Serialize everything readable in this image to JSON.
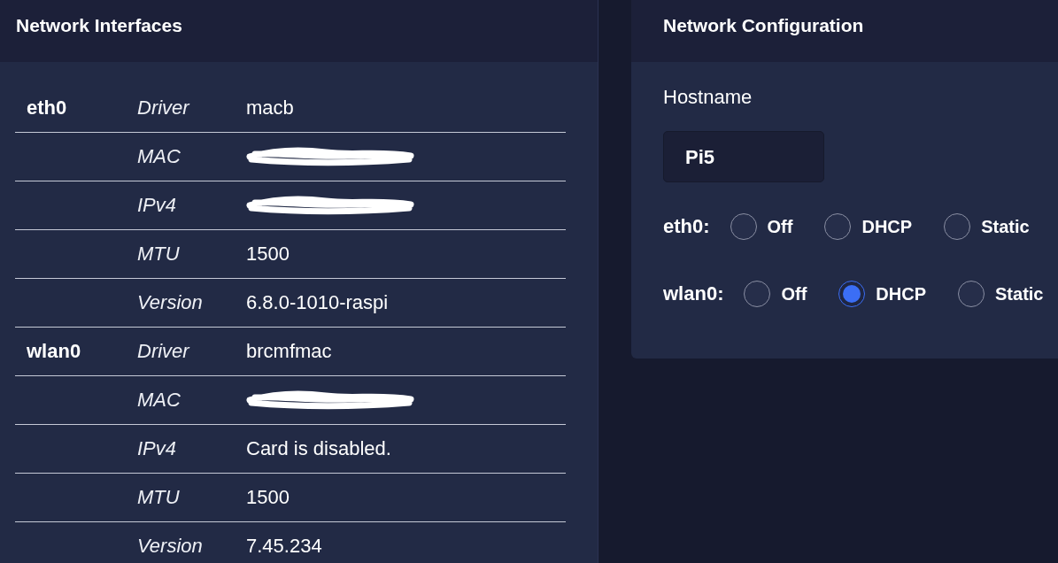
{
  "interfaces_panel": {
    "title": "Network Interfaces",
    "interfaces": [
      {
        "name": "eth0",
        "properties": [
          {
            "key": "Driver",
            "redacted": false,
            "value": "macb"
          },
          {
            "key": "MAC",
            "redacted": true
          },
          {
            "key": "IPv4",
            "redacted": true
          },
          {
            "key": "MTU",
            "redacted": false,
            "value": "1500"
          },
          {
            "key": "Version",
            "redacted": false,
            "value": "6.8.0-1010-raspi"
          }
        ]
      },
      {
        "name": "wlan0",
        "properties": [
          {
            "key": "Driver",
            "redacted": false,
            "value": "brcmfmac"
          },
          {
            "key": "MAC",
            "redacted": true
          },
          {
            "key": "IPv4",
            "redacted": false,
            "value": "Card is disabled."
          },
          {
            "key": "MTU",
            "redacted": false,
            "value": "1500"
          },
          {
            "key": "Version",
            "redacted": false,
            "value": "7.45.234"
          }
        ]
      }
    ]
  },
  "config_panel": {
    "title": "Network Configuration",
    "hostname": {
      "label": "Hostname",
      "value": "Pi5"
    },
    "interfaces": [
      {
        "label": "eth0:",
        "options": [
          {
            "label": "Off",
            "selected": false
          },
          {
            "label": "DHCP",
            "selected": false
          },
          {
            "label": "Static",
            "selected": false
          }
        ]
      },
      {
        "label": "wlan0:",
        "options": [
          {
            "label": "Off",
            "selected": false
          },
          {
            "label": "DHCP",
            "selected": true
          },
          {
            "label": "Static",
            "selected": false
          }
        ]
      }
    ]
  }
}
